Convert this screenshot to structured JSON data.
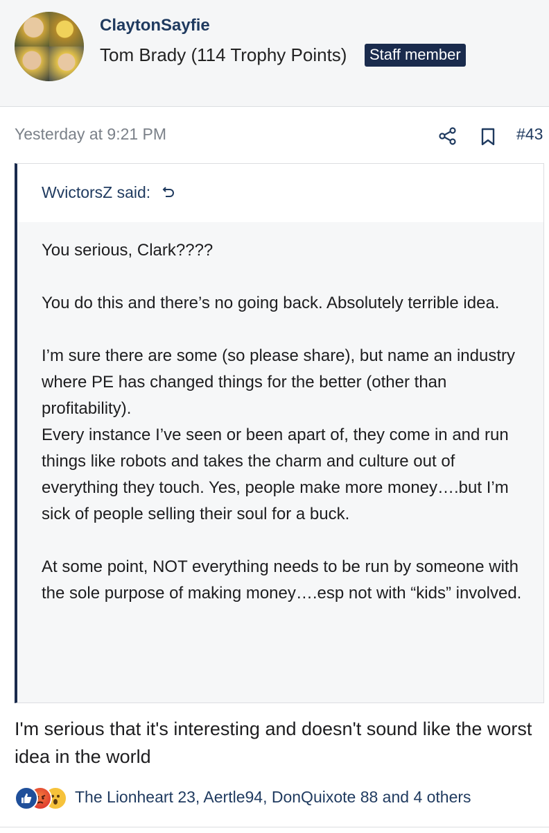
{
  "user": {
    "name": "ClaytonSayfie",
    "title": "Tom Brady (114 Trophy Points)",
    "badge": "Staff member"
  },
  "post": {
    "timestamp": "Yesterday at 9:21 PM",
    "number": "#43",
    "icons": [
      "share-icon",
      "bookmark-icon"
    ],
    "body": "I'm serious that it's interesting and doesn't sound like the worst idea in the world"
  },
  "quote": {
    "author": "WvictorsZ said:",
    "paragraphs": [
      "You serious, Clark????",
      "You do this and there’s no going back. Absolutely terrible idea.",
      "I’m sure there are some (so please share), but name an industry where PE has changed things for the better (other than profitability).\nEvery instance I’ve seen or been apart of, they come in and run things like robots and takes the charm and culture out of everything they touch. Yes, people make more money….but I’m sick of people selling their soul for a buck.",
      "At some point, NOT everything needs to be run by someone with the sole purpose of making money….esp not with “kids” involved."
    ]
  },
  "reactions": {
    "types": [
      "like-icon",
      "angry-icon",
      "wow-icon"
    ],
    "users": "The Lionheart 23, Aertle94, DonQuixote 88 and 4 others"
  },
  "colors": {
    "accent": "#1f3a5f",
    "badge_bg": "#1a2b4d",
    "meta": "#7b8189",
    "quote_bg": "#f6f7f8"
  }
}
